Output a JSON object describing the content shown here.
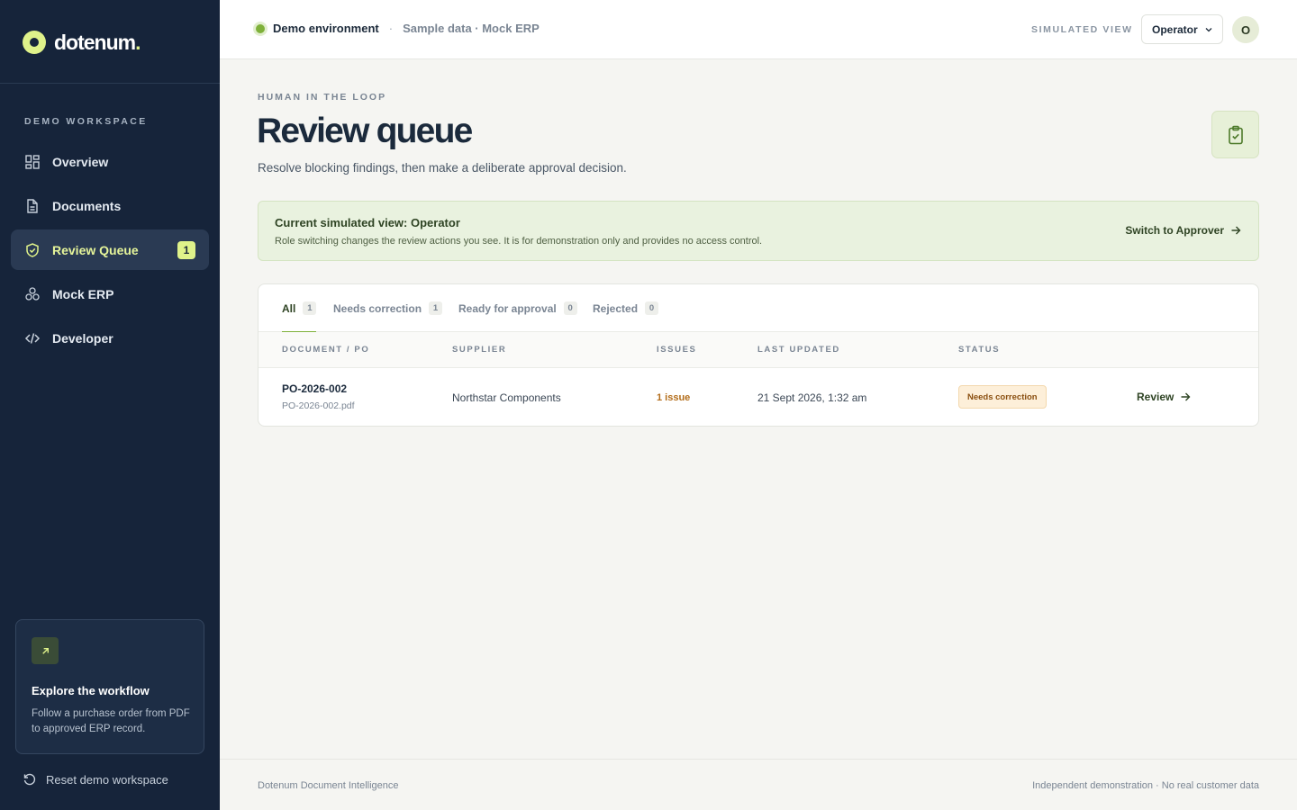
{
  "brand": {
    "name": "dotenum",
    "dot": "."
  },
  "sidebar": {
    "section_label": "DEMO WORKSPACE",
    "items": [
      {
        "label": "Overview",
        "icon": "grid-icon"
      },
      {
        "label": "Documents",
        "icon": "document-icon"
      },
      {
        "label": "Review Queue",
        "icon": "shield-check-icon",
        "badge": "1",
        "active": true
      },
      {
        "label": "Mock ERP",
        "icon": "network-icon"
      },
      {
        "label": "Developer",
        "icon": "code-icon"
      }
    ],
    "promo": {
      "title": "Explore the workflow",
      "body": "Follow a purchase order from PDF to approved ERP record.",
      "icon": "arrow-up-right-icon"
    },
    "reset_label": "Reset demo workspace"
  },
  "topbar": {
    "env_name": "Demo environment",
    "separator": "·",
    "env_sub": "Sample data · Mock ERP",
    "simulated_label": "SIMULATED VIEW",
    "role_value": "Operator",
    "avatar_initial": "O"
  },
  "page": {
    "eyebrow": "HUMAN IN THE LOOP",
    "title": "Review queue",
    "subtitle": "Resolve blocking findings, then make a deliberate approval decision."
  },
  "notice": {
    "title": "Current simulated view: Operator",
    "body": "Role switching changes the review actions you see. It is for demonstration only and provides no access control.",
    "link": "Switch to Approver"
  },
  "tabs": [
    {
      "label": "All",
      "count": "1"
    },
    {
      "label": "Needs correction",
      "count": "1"
    },
    {
      "label": "Ready for approval",
      "count": "0"
    },
    {
      "label": "Rejected",
      "count": "0"
    }
  ],
  "table": {
    "columns": [
      "DOCUMENT / PO",
      "SUPPLIER",
      "ISSUES",
      "LAST UPDATED",
      "STATUS"
    ],
    "rows": [
      {
        "po": "PO-2026-002",
        "file": "PO-2026-002.pdf",
        "supplier": "Northstar Components",
        "issues": "1 issue",
        "updated": "21 Sept 2026, 1:32 am",
        "status": "Needs correction",
        "action": "Review"
      }
    ]
  },
  "footer": {
    "left": "Dotenum Document Intelligence",
    "right": "Independent demonstration · No real customer data"
  },
  "colors": {
    "sidebar_bg": "#16243a",
    "accent_lime": "#dff28a",
    "accent_green": "#7fb13a",
    "warning": "#b36d1a"
  }
}
